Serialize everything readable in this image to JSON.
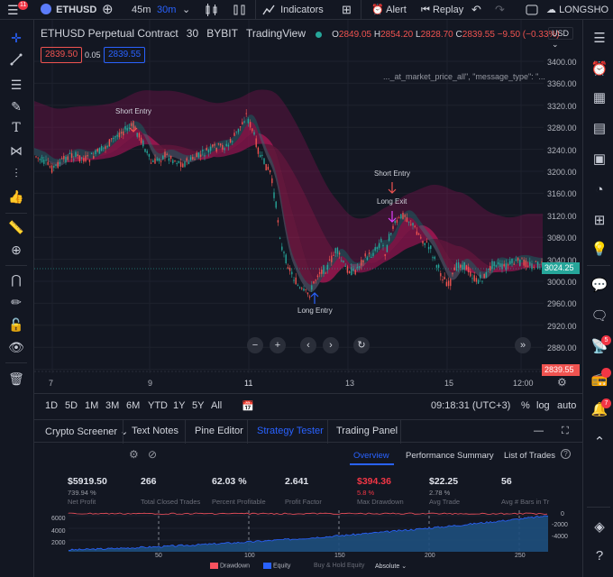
{
  "topbar": {
    "menu_badge": "11",
    "symbol": "ETHUSD",
    "interval_1": "45m",
    "interval_2": "30m",
    "indicators_label": "Indicators",
    "alert_label": "Alert",
    "replay_label": "Replay",
    "layout_name": "LONGSHO"
  },
  "legend": {
    "title": "ETHUSD Perpetual Contract",
    "interval": "30",
    "exchange": "BYBIT",
    "platform": "TradingView",
    "o_label": "O",
    "o": "2849.05",
    "h_label": "H",
    "h": "2854.20",
    "l_label": "L",
    "l": "2828.70",
    "c_label": "C",
    "c": "2839.55",
    "change": "−9.50 (−0.33%)",
    "sell_price": "2839.50",
    "spread": "0.05",
    "buy_price": "2839.55",
    "message_text": "..._at_market_price_all\", \"message_type\": \"..."
  },
  "price_axis": {
    "currency": "USD",
    "labels": [
      "3400.00",
      "3360.00",
      "3320.00",
      "3280.00",
      "3240.00",
      "3200.00",
      "3160.00",
      "3120.00",
      "3080.00",
      "3040.00",
      "3000.00",
      "2960.00",
      "2920.00",
      "2880.00",
      "2840.00"
    ],
    "current_price": "3024.25",
    "last_price": "2839.55"
  },
  "time_axis": {
    "labels": [
      "7",
      "9",
      "11",
      "13",
      "15",
      "12:00"
    ]
  },
  "annotations": {
    "short_entry_1": "Short Entry",
    "short_entry_2": "Short Entry",
    "long_exit": "Long Exit",
    "long_entry": "Long Entry"
  },
  "timeframes": {
    "items": [
      "1D",
      "5D",
      "1M",
      "3M",
      "6M",
      "YTD",
      "1Y",
      "5Y",
      "All"
    ],
    "clock": "09:18:31 (UTC+3)",
    "percent_label": "%",
    "log_label": "log",
    "auto_label": "auto"
  },
  "bottom_tabs": {
    "items": [
      "Crypto Screener",
      "Text Notes",
      "Pine Editor",
      "Strategy Tester",
      "Trading Panel"
    ],
    "active": "Strategy Tester"
  },
  "strategy": {
    "subtabs": [
      "Overview",
      "Performance Summary",
      "List of Trades"
    ],
    "stats": [
      {
        "value": "$5919.50",
        "sub": "739.94 %",
        "label": "Net Profit",
        "color": "#e0e3eb"
      },
      {
        "value": "266",
        "sub": "",
        "label": "Total Closed Trades",
        "color": "#e0e3eb"
      },
      {
        "value": "62.03 %",
        "sub": "",
        "label": "Percent Profitable",
        "color": "#e0e3eb"
      },
      {
        "value": "2.641",
        "sub": "",
        "label": "Profit Factor",
        "color": "#e0e3eb"
      },
      {
        "value": "$394.36",
        "sub": "5.8 %",
        "label": "Max Drawdown",
        "color": "#f23645"
      },
      {
        "value": "$22.25",
        "sub": "2.78 %",
        "label": "Avg Trade",
        "color": "#e0e3eb"
      },
      {
        "value": "56",
        "sub": "",
        "label": "Avg # Bars in Tr",
        "color": "#e0e3eb"
      }
    ],
    "equity_left_axis": [
      "6000",
      "4000",
      "2000"
    ],
    "equity_right_axis": [
      "0",
      "-2000",
      "-4000"
    ],
    "equity_x_axis": [
      "50",
      "100",
      "150",
      "200",
      "250"
    ],
    "legend": {
      "drawdown": "Drawdown",
      "equity": "Equity",
      "buy_hold": "Buy & Hold Equity",
      "absolute": "Absolute"
    }
  },
  "colors": {
    "background": "#131722",
    "accent": "#2962ff",
    "bull": "#26a69a",
    "bear": "#ef5350",
    "ribbon_red": "#c2185b",
    "ribbon_teal": "#00897b"
  }
}
